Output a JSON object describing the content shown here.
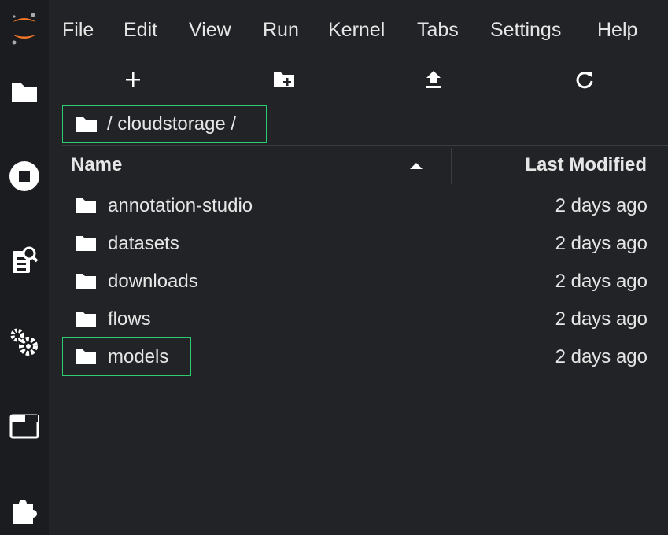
{
  "menu": [
    "File",
    "Edit",
    "View",
    "Run",
    "Kernel",
    "Tabs",
    "Settings",
    "Help"
  ],
  "breadcrumb": {
    "path": "/ cloudstorage /"
  },
  "columns": {
    "name": "Name",
    "modified": "Last Modified",
    "sort": "ascending"
  },
  "files": [
    {
      "name": "annotation-studio",
      "modified": "2 days ago",
      "type": "folder"
    },
    {
      "name": "datasets",
      "modified": "2 days ago",
      "type": "folder"
    },
    {
      "name": "downloads",
      "modified": "2 days ago",
      "type": "folder"
    },
    {
      "name": "flows",
      "modified": "2 days ago",
      "type": "folder"
    },
    {
      "name": "models",
      "modified": "2 days ago",
      "type": "folder"
    }
  ],
  "toolbar": [
    "new-launcher-icon",
    "new-folder-icon",
    "upload-icon",
    "refresh-icon"
  ],
  "sidebar_icons": [
    "jupyter-logo",
    "file-browser-icon",
    "running-icon",
    "property-inspector-icon",
    "settings-icon",
    "tabs-icon",
    "extension-icon"
  ],
  "colors": {
    "background": "#212326",
    "text": "#e6e6e6",
    "highlight": "#2ecc71",
    "logo": "#f37726"
  }
}
